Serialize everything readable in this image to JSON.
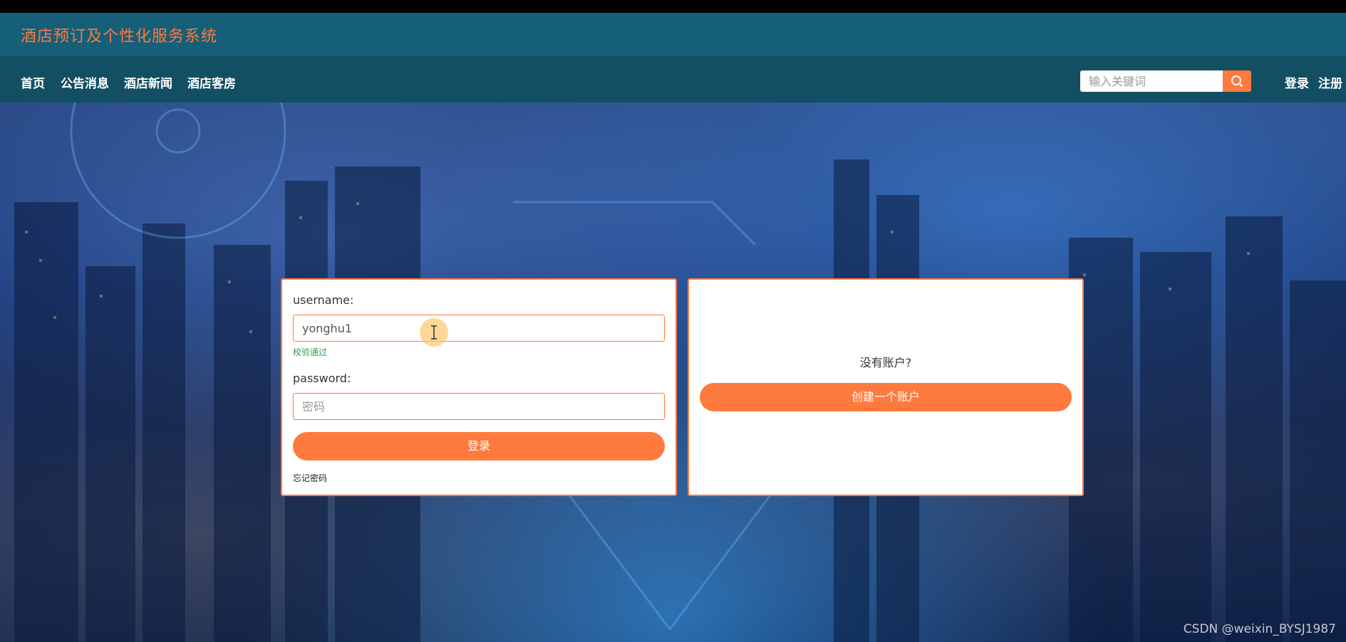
{
  "header": {
    "title": "酒店预订及个性化服务系统"
  },
  "nav": {
    "items": [
      "首页",
      "公告消息",
      "酒店新闻",
      "酒店客房"
    ],
    "search_placeholder": "输入关键词",
    "login": "登录",
    "register": "注册"
  },
  "login_form": {
    "username_label": "username:",
    "username_value": "yonghu1",
    "validation_ok": "校验通过",
    "password_label": "password:",
    "password_placeholder": "密码",
    "submit": "登录",
    "forgot": "忘记密码"
  },
  "register_panel": {
    "prompt": "没有账户?",
    "create_button": "创建一个账户"
  },
  "watermark": "CSDN @weixin_BYSJ1987",
  "colors": {
    "header": "#155f79",
    "nav": "#134f63",
    "accent": "#ff7a3d"
  }
}
